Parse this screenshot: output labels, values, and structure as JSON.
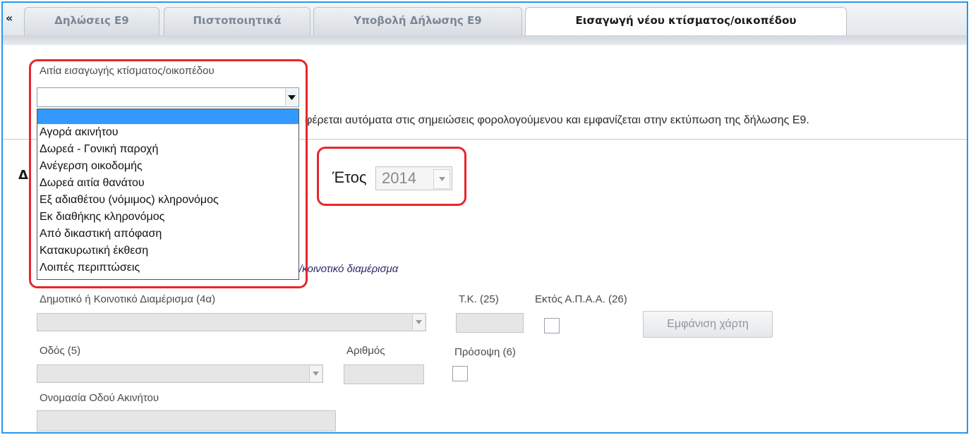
{
  "tabs": {
    "collapse_glyph": "«",
    "items": [
      {
        "label": "Δηλώσεις Ε9"
      },
      {
        "label": "Πιστοποιητικά"
      },
      {
        "label": "Υποβολή Δήλωσης Ε9"
      },
      {
        "label": "Εισαγωγή νέου κτίσματος/οικοπέδου",
        "active": true
      }
    ]
  },
  "cause": {
    "label": "Αιτία εισαγωγής κτίσματος/οικοπέδου",
    "value": "",
    "options": [
      "",
      "Αγορά ακινήτου",
      "Δωρεά - Γονική παροχή",
      "Ανέγερση οικοδομής",
      "Δωρεά αιτία θανάτου",
      "Εξ αδιαθέτου (νόμιμος) κληρονόμος",
      "Εκ διαθήκης κληρονόμος",
      "Από δικαστική απόφαση",
      "Κατακυρωτική έκθεση",
      "Λοιπές περιπτώσεις"
    ]
  },
  "note_text": "φέρεται αυτόματα στις σημειώσεις φορολογούμενου και εμφανίζεται στην εκτύπωση της δήλωσης Ε9.",
  "section_title_partial": "Δ",
  "year": {
    "label": "Έτος",
    "value": "2014"
  },
  "location_hint": "/κοινοτικό διαμέρισμα",
  "fields": {
    "district_label": "Δημοτικό ή Κοινοτικό Διαμέρισμα (4α)",
    "postcode_label": "Τ.Κ. (25)",
    "outside_apaa_label": "Εκτός Α.Π.Α.Α. (26)",
    "show_map_button": "Εμφάνιση χάρτη",
    "street_label": "Οδός (5)",
    "number_label": "Αριθμός",
    "frontage_label": "Πρόσοψη (6)",
    "street_name_label": "Ονομασία Οδού Ακινήτου"
  },
  "colors": {
    "highlight_red": "#e8262c",
    "frame_blue": "#2a96e6",
    "selection_blue": "#3399ff"
  }
}
